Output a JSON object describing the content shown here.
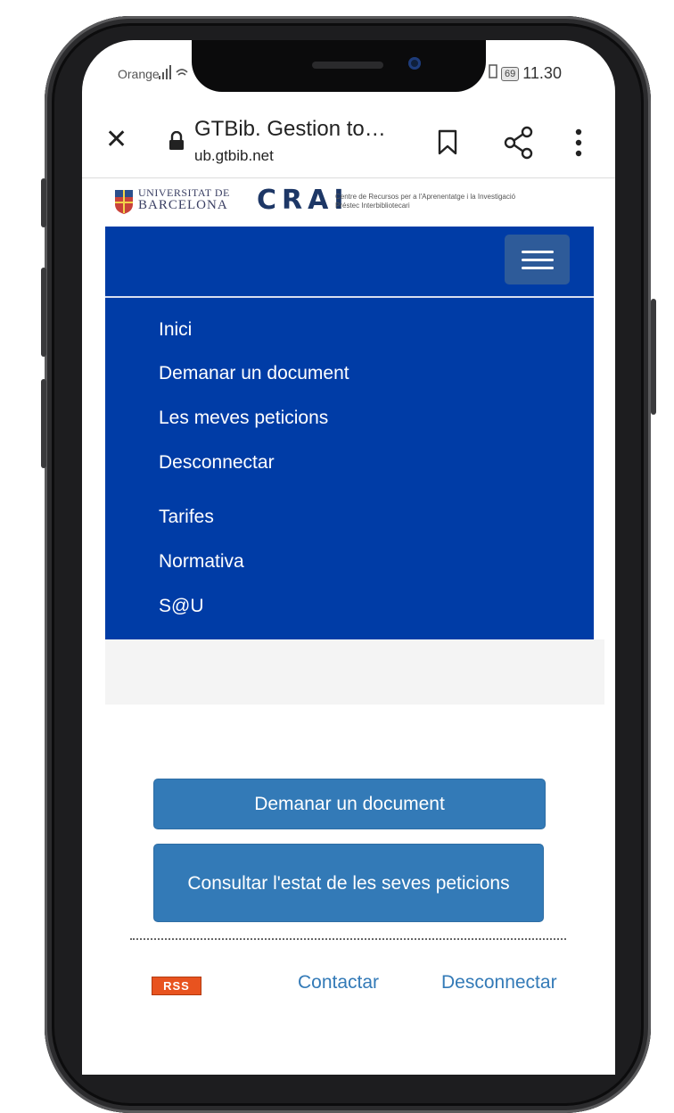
{
  "status_bar": {
    "carrier": "Orange",
    "battery": "69",
    "time": "11.30"
  },
  "browser": {
    "tab_title": "GTBib. Gestion to…",
    "url": "ub.gtbib.net"
  },
  "site_header": {
    "university_line1": "UNIVERSITAT DE",
    "university_line2": "BARCELONA",
    "crai": "CRAI",
    "crai_subtitle_line1": "Centre de Recursos per a l'Aprenentatge i la Investigació",
    "crai_subtitle_line2": "Préstec Interbibliotecari"
  },
  "nav": {
    "items": [
      {
        "label": "Inici"
      },
      {
        "label": "Demanar un document"
      },
      {
        "label": "Les meves peticions"
      },
      {
        "label": "Desconnectar"
      },
      {
        "label": "Tarifes"
      },
      {
        "label": "Normativa"
      },
      {
        "label": "S@U"
      }
    ]
  },
  "main": {
    "request_button": "Demanar un document",
    "status_button": "Consultar l'estat de les seves peticions"
  },
  "footer": {
    "rss": "RSS",
    "contact": "Contactar",
    "logout": "Desconnectar"
  },
  "colors": {
    "nav_bg": "#003ca6",
    "button_bg": "#337ab7",
    "link": "#337ab7",
    "rss": "#e8531f"
  }
}
